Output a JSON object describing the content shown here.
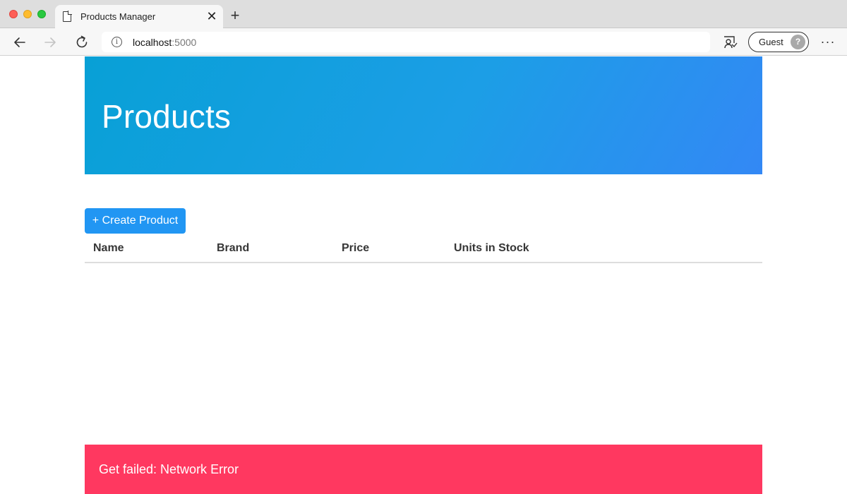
{
  "browser": {
    "tab_title": "Products Manager",
    "tab_close_glyph": "✕",
    "new_tab_glyph": "+",
    "url_host": "localhost",
    "url_port": ":5000",
    "profile_label": "Guest",
    "icons": {
      "back": "arrow-left-icon",
      "forward": "arrow-right-icon",
      "reload": "reload-icon",
      "info": "info-icon",
      "reading": "reading-mode-icon",
      "avatar": "guest-avatar-icon",
      "more": "more-icon"
    }
  },
  "page": {
    "hero_title": "Products",
    "create_button_label": "+ Create Product",
    "table": {
      "columns": [
        "Name",
        "Brand",
        "Price",
        "Units in Stock"
      ],
      "rows": []
    },
    "error_message": "Get failed: Network Error"
  },
  "colors": {
    "hero_gradient_start": "#08a0d6",
    "hero_gradient_end": "#3388f5",
    "primary_button": "#2196f3",
    "error_background": "#ff3860"
  }
}
